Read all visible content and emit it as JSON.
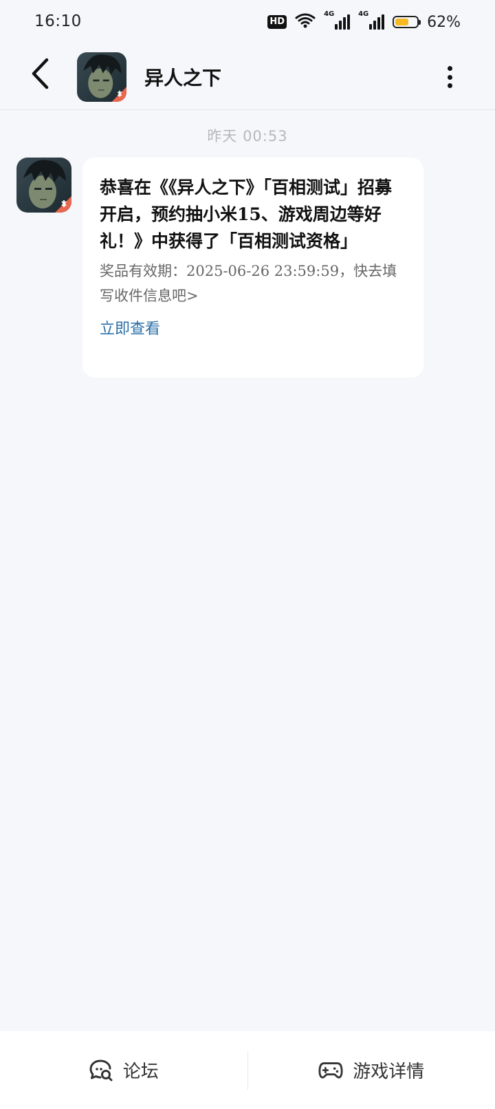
{
  "status_bar": {
    "time": "16:10",
    "hd_label": "HD",
    "sim1_label": "4G",
    "sim2_label": "4G",
    "battery_percent": "62%",
    "battery_level": 0.62,
    "battery_color": "#f5b921"
  },
  "header": {
    "back_icon": "chevron-left-icon",
    "title": "异人之下",
    "more_icon": "more-vertical-icon"
  },
  "chat": {
    "timestamp": "昨天  00:53",
    "message": {
      "title": "恭喜在《《异人之下》「百相测试」招募开启，预约抽小米15、游戏周边等好礼！》中获得了「百相测试资格」",
      "description": "奖品有效期：2025-06-26 23:59:59，快去填写收件信息吧>",
      "link_label": "立即查看",
      "link_color": "#2a6ea8"
    }
  },
  "bottom_nav": {
    "forum_label": "论坛",
    "forum_icon": "chat-search-icon",
    "game_details_label": "游戏详情",
    "game_details_icon": "gamepad-icon"
  }
}
